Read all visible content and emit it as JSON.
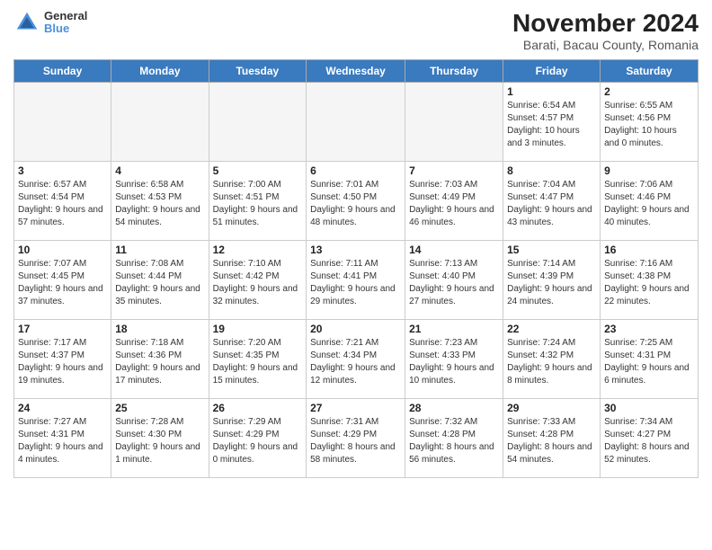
{
  "header": {
    "title": "November 2024",
    "subtitle": "Barati, Bacau County, Romania",
    "logo_line1": "General",
    "logo_line2": "Blue"
  },
  "days_of_week": [
    "Sunday",
    "Monday",
    "Tuesday",
    "Wednesday",
    "Thursday",
    "Friday",
    "Saturday"
  ],
  "weeks": [
    [
      {
        "day": "",
        "info": "",
        "empty": true
      },
      {
        "day": "",
        "info": "",
        "empty": true
      },
      {
        "day": "",
        "info": "",
        "empty": true
      },
      {
        "day": "",
        "info": "",
        "empty": true
      },
      {
        "day": "",
        "info": "",
        "empty": true
      },
      {
        "day": "1",
        "info": "Sunrise: 6:54 AM\nSunset: 4:57 PM\nDaylight: 10 hours and 3 minutes."
      },
      {
        "day": "2",
        "info": "Sunrise: 6:55 AM\nSunset: 4:56 PM\nDaylight: 10 hours and 0 minutes."
      }
    ],
    [
      {
        "day": "3",
        "info": "Sunrise: 6:57 AM\nSunset: 4:54 PM\nDaylight: 9 hours and 57 minutes."
      },
      {
        "day": "4",
        "info": "Sunrise: 6:58 AM\nSunset: 4:53 PM\nDaylight: 9 hours and 54 minutes."
      },
      {
        "day": "5",
        "info": "Sunrise: 7:00 AM\nSunset: 4:51 PM\nDaylight: 9 hours and 51 minutes."
      },
      {
        "day": "6",
        "info": "Sunrise: 7:01 AM\nSunset: 4:50 PM\nDaylight: 9 hours and 48 minutes."
      },
      {
        "day": "7",
        "info": "Sunrise: 7:03 AM\nSunset: 4:49 PM\nDaylight: 9 hours and 46 minutes."
      },
      {
        "day": "8",
        "info": "Sunrise: 7:04 AM\nSunset: 4:47 PM\nDaylight: 9 hours and 43 minutes."
      },
      {
        "day": "9",
        "info": "Sunrise: 7:06 AM\nSunset: 4:46 PM\nDaylight: 9 hours and 40 minutes."
      }
    ],
    [
      {
        "day": "10",
        "info": "Sunrise: 7:07 AM\nSunset: 4:45 PM\nDaylight: 9 hours and 37 minutes."
      },
      {
        "day": "11",
        "info": "Sunrise: 7:08 AM\nSunset: 4:44 PM\nDaylight: 9 hours and 35 minutes."
      },
      {
        "day": "12",
        "info": "Sunrise: 7:10 AM\nSunset: 4:42 PM\nDaylight: 9 hours and 32 minutes."
      },
      {
        "day": "13",
        "info": "Sunrise: 7:11 AM\nSunset: 4:41 PM\nDaylight: 9 hours and 29 minutes."
      },
      {
        "day": "14",
        "info": "Sunrise: 7:13 AM\nSunset: 4:40 PM\nDaylight: 9 hours and 27 minutes."
      },
      {
        "day": "15",
        "info": "Sunrise: 7:14 AM\nSunset: 4:39 PM\nDaylight: 9 hours and 24 minutes."
      },
      {
        "day": "16",
        "info": "Sunrise: 7:16 AM\nSunset: 4:38 PM\nDaylight: 9 hours and 22 minutes."
      }
    ],
    [
      {
        "day": "17",
        "info": "Sunrise: 7:17 AM\nSunset: 4:37 PM\nDaylight: 9 hours and 19 minutes."
      },
      {
        "day": "18",
        "info": "Sunrise: 7:18 AM\nSunset: 4:36 PM\nDaylight: 9 hours and 17 minutes."
      },
      {
        "day": "19",
        "info": "Sunrise: 7:20 AM\nSunset: 4:35 PM\nDaylight: 9 hours and 15 minutes."
      },
      {
        "day": "20",
        "info": "Sunrise: 7:21 AM\nSunset: 4:34 PM\nDaylight: 9 hours and 12 minutes."
      },
      {
        "day": "21",
        "info": "Sunrise: 7:23 AM\nSunset: 4:33 PM\nDaylight: 9 hours and 10 minutes."
      },
      {
        "day": "22",
        "info": "Sunrise: 7:24 AM\nSunset: 4:32 PM\nDaylight: 9 hours and 8 minutes."
      },
      {
        "day": "23",
        "info": "Sunrise: 7:25 AM\nSunset: 4:31 PM\nDaylight: 9 hours and 6 minutes."
      }
    ],
    [
      {
        "day": "24",
        "info": "Sunrise: 7:27 AM\nSunset: 4:31 PM\nDaylight: 9 hours and 4 minutes."
      },
      {
        "day": "25",
        "info": "Sunrise: 7:28 AM\nSunset: 4:30 PM\nDaylight: 9 hours and 1 minute."
      },
      {
        "day": "26",
        "info": "Sunrise: 7:29 AM\nSunset: 4:29 PM\nDaylight: 9 hours and 0 minutes."
      },
      {
        "day": "27",
        "info": "Sunrise: 7:31 AM\nSunset: 4:29 PM\nDaylight: 8 hours and 58 minutes."
      },
      {
        "day": "28",
        "info": "Sunrise: 7:32 AM\nSunset: 4:28 PM\nDaylight: 8 hours and 56 minutes."
      },
      {
        "day": "29",
        "info": "Sunrise: 7:33 AM\nSunset: 4:28 PM\nDaylight: 8 hours and 54 minutes."
      },
      {
        "day": "30",
        "info": "Sunrise: 7:34 AM\nSunset: 4:27 PM\nDaylight: 8 hours and 52 minutes."
      }
    ]
  ]
}
